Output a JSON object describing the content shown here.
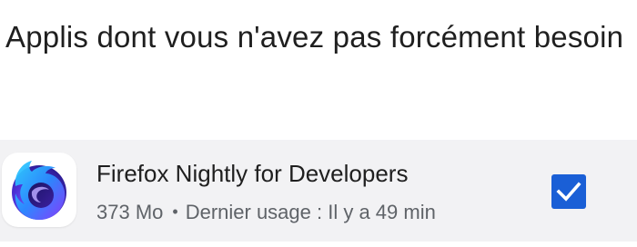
{
  "section": {
    "title": "Applis dont vous n'avez pas forcément besoin"
  },
  "apps": [
    {
      "name": "Firefox Nightly for Developers",
      "size": "373 Mo",
      "separator": "•",
      "last_used": "Dernier usage : Il y a 49 min",
      "icon": "firefox-nightly-icon",
      "selected": true
    }
  ],
  "colors": {
    "checkbox_accent": "#1a5fd6",
    "row_background": "#f2f2f4",
    "primary_text": "#1f1f1f",
    "secondary_text": "#5f6368"
  }
}
